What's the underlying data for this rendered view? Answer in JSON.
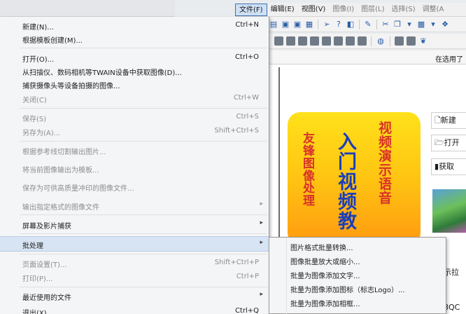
{
  "menubar": {
    "items": [
      {
        "label": "文件(F)",
        "state": "active"
      },
      {
        "label": "编辑(E)",
        "state": "normal"
      },
      {
        "label": "视图(V)",
        "state": "normal"
      },
      {
        "label": "图像(I)",
        "state": "dim"
      },
      {
        "label": "图层(L)",
        "state": "dim"
      },
      {
        "label": "选择(S)",
        "state": "dim"
      },
      {
        "label": "调整(A",
        "state": "dim"
      }
    ]
  },
  "status_text": "在选用了",
  "file_menu": {
    "items": [
      {
        "label": "新建(N)...",
        "shortcut": "Ctrl+N",
        "disabled": false,
        "submenu": false
      },
      {
        "label": "根据模板创建(M)...",
        "shortcut": "",
        "disabled": false,
        "submenu": false
      },
      {
        "label": "打开(O)...",
        "shortcut": "Ctrl+O",
        "disabled": false,
        "submenu": false
      },
      {
        "label": "从扫描仪、数码相机等TWAIN设备中获取图像(D)...",
        "shortcut": "",
        "disabled": false,
        "submenu": false
      },
      {
        "label": "捕获摄像头等设备拍摄的图像...",
        "shortcut": "",
        "disabled": false,
        "submenu": false
      },
      {
        "label": "关闭(C)",
        "shortcut": "Ctrl+W",
        "disabled": true,
        "submenu": false
      },
      {
        "label": "保存(S)",
        "shortcut": "Ctrl+S",
        "disabled": true,
        "submenu": false
      },
      {
        "label": "另存为(A)...",
        "shortcut": "Shift+Ctrl+S",
        "disabled": true,
        "submenu": false
      },
      {
        "label": "根据参考线切割输出图片...",
        "shortcut": "",
        "disabled": true,
        "submenu": false
      },
      {
        "label": "将当前图像输出为模板...",
        "shortcut": "",
        "disabled": true,
        "submenu": false
      },
      {
        "label": "保存为可供高质量冲印的图像文件...",
        "shortcut": "",
        "disabled": true,
        "submenu": false
      },
      {
        "label": "输出指定格式的图像文件",
        "shortcut": "",
        "disabled": true,
        "submenu": true
      },
      {
        "label": "屏幕及影片捕获",
        "shortcut": "",
        "disabled": false,
        "submenu": true
      },
      {
        "label": "批处理",
        "shortcut": "",
        "disabled": false,
        "submenu": true,
        "highlighted": true
      },
      {
        "label": "页面设置(T)...",
        "shortcut": "Shift+Ctrl+P",
        "disabled": true,
        "submenu": false
      },
      {
        "label": "打印(P)...",
        "shortcut": "Ctrl+P",
        "disabled": true,
        "submenu": false
      },
      {
        "label": "最近使用的文件",
        "shortcut": "",
        "disabled": false,
        "submenu": true
      },
      {
        "label": "退出(X)",
        "shortcut": "Ctrl+Q",
        "disabled": false,
        "submenu": false
      }
    ]
  },
  "batch_submenu": {
    "items": [
      {
        "label": "图片格式批量转换..."
      },
      {
        "label": "图像批量放大或缩小..."
      },
      {
        "label": "批量为图像添加文字..."
      },
      {
        "label": "批量为图像添加图标（标志Logo）..."
      },
      {
        "label": "批量为图像添加相框..."
      }
    ]
  },
  "poster": {
    "left_chars": [
      "友",
      "锋",
      "图",
      "像",
      "处",
      "理"
    ],
    "mid_chars": [
      "入",
      "门",
      "视",
      "频",
      "教"
    ],
    "right_chars": [
      "视",
      "频",
      "演",
      "示",
      "语",
      "音"
    ]
  },
  "side_cards": [
    {
      "icon": "new-document-icon",
      "label": "新建"
    },
    {
      "icon": "open-folder-icon",
      "label": "打开"
    },
    {
      "icon": "capture-icon",
      "label": "获取"
    }
  ],
  "side_texts": [
    "示拉",
    "8QC"
  ],
  "colors": {
    "menu_highlight": "#d7e4f3",
    "menubar_active": "#cfe0f5",
    "poster_top": "#ffe11a",
    "poster_bottom": "#ff9a10",
    "poster_red_text": "#d8322a",
    "poster_blue_text": "#1d3fb8"
  }
}
